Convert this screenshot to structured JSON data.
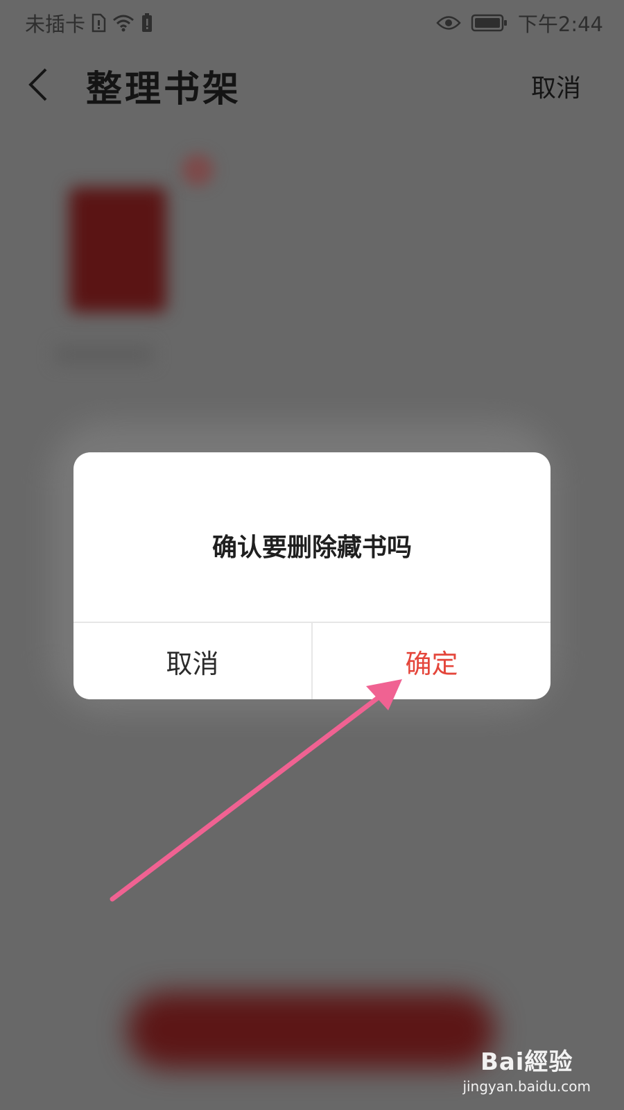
{
  "status_bar": {
    "carrier": "未插卡",
    "time": "下午2:44",
    "icons": [
      "sim-icon",
      "wifi-icon",
      "battery-alert-icon",
      "eye-icon",
      "battery-icon"
    ]
  },
  "nav": {
    "back_icon": "chevron-left-icon",
    "title": "整理书架",
    "cancel_label": "取消"
  },
  "dialog": {
    "message": "确认要删除藏书吗",
    "cancel_label": "取消",
    "confirm_label": "确定"
  },
  "colors": {
    "confirm": "#e4463b",
    "overlay": "#686868",
    "arrow": "#f06292"
  },
  "watermark": {
    "logo": "Bai經验",
    "sub": "jingyan.baidu.com"
  }
}
